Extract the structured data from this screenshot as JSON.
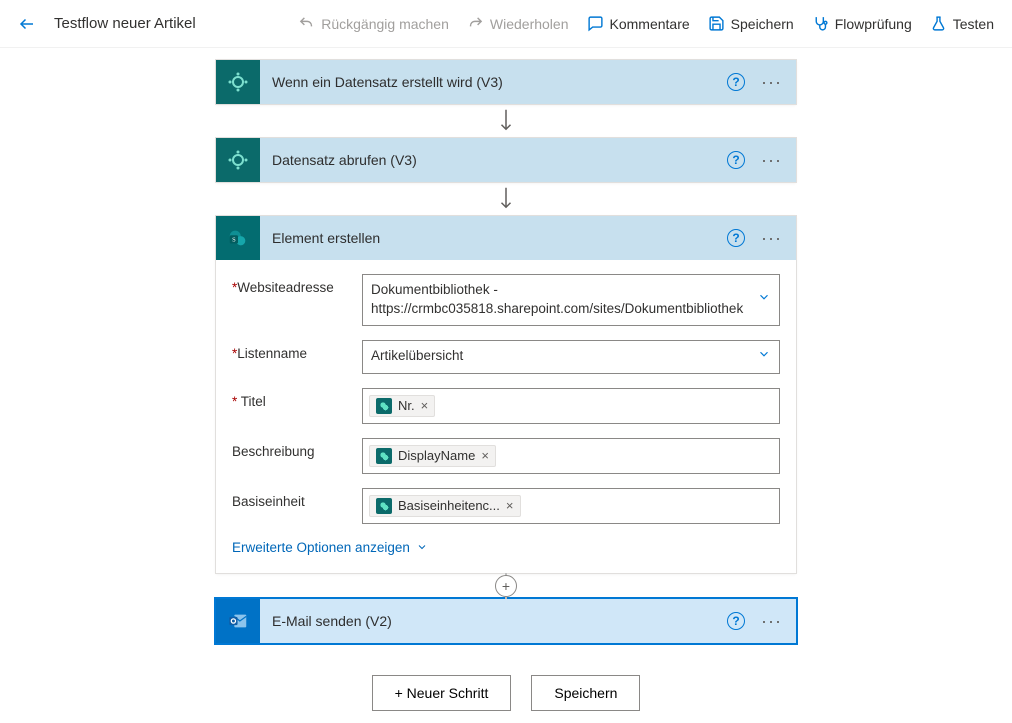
{
  "header": {
    "title": "Testflow neuer Artikel",
    "undo": "Rückgängig machen",
    "redo": "Wiederholen",
    "comments": "Kommentare",
    "save": "Speichern",
    "check": "Flowprüfung",
    "test": "Testen"
  },
  "cards": {
    "c1": {
      "title": "Wenn ein Datensatz erstellt wird (V3)"
    },
    "c2": {
      "title": "Datensatz abrufen (V3)"
    },
    "c3": {
      "title": "Element erstellen",
      "fields": {
        "siteAddress": {
          "label": "Websiteadresse",
          "value": "Dokumentbibliothek - https://crmbc035818.sharepoint.com/sites/Dokumentbibliothek"
        },
        "listName": {
          "label": "Listenname",
          "value": "Artikelübersicht"
        },
        "title": {
          "label": "Titel",
          "token": "Nr."
        },
        "description": {
          "label": "Beschreibung",
          "token": "DisplayName"
        },
        "baseUnit": {
          "label": "Basiseinheit",
          "token": "Basiseinheitenc..."
        }
      },
      "advanced": "Erweiterte Optionen anzeigen"
    },
    "c4": {
      "title": "E-Mail senden (V2)"
    }
  },
  "footer": {
    "newStep": "+ Neuer Schritt",
    "save": "Speichern"
  },
  "tokenRemove": "×"
}
